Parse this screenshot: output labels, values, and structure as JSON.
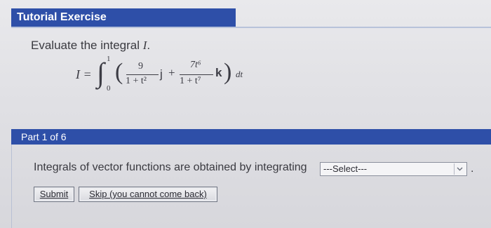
{
  "section_title": "Tutorial Exercise",
  "prompt": {
    "text": "Evaluate the integral ",
    "variable": "I",
    "end": "."
  },
  "formula": {
    "lhs": "I =",
    "integral_sign": "∫",
    "upper_limit": "1",
    "lower_limit": "0",
    "open_paren": "(",
    "close_paren": ")",
    "term1_numerator": "9",
    "term1_denominator": "1 + t²",
    "term1_vector": "j",
    "plus": "+",
    "term2_numerator": "7t⁶",
    "term2_denominator": "1 + t⁷",
    "term2_vector": "k",
    "differential": "dt"
  },
  "part": {
    "label": "Part 1 of 6",
    "question": "Integrals of vector functions are obtained by integrating",
    "select_value": "---Select---",
    "end_punct": "."
  },
  "buttons": {
    "submit": "Submit",
    "skip": "Skip (you cannot come back)"
  }
}
